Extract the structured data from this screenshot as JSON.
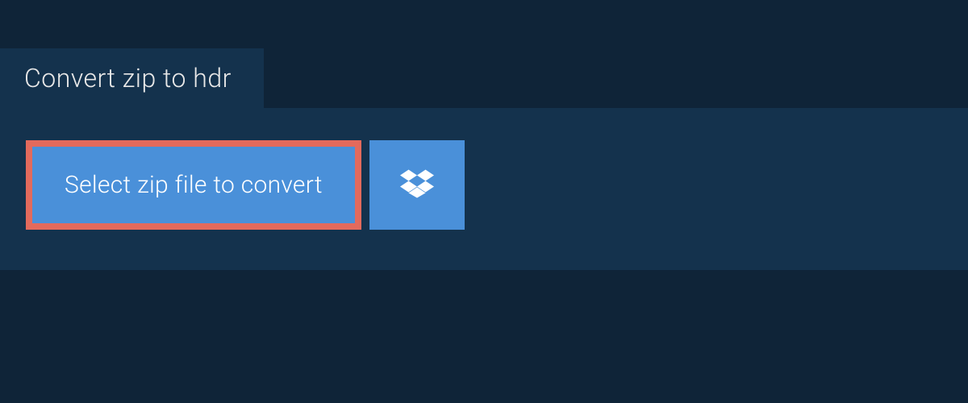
{
  "tab": {
    "title": "Convert zip to hdr"
  },
  "actions": {
    "select_file_label": "Select zip file to convert"
  },
  "colors": {
    "background": "#0f2438",
    "panel": "#14324d",
    "button": "#4a90d9",
    "highlight_border": "#e36a5c",
    "text_light": "#ffffff"
  }
}
